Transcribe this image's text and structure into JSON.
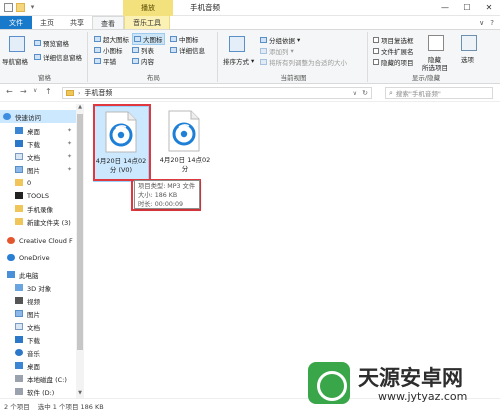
{
  "titlebar": {
    "context_tab": "播放",
    "window_title": "手机音频",
    "buttons": [
      "—",
      "☐",
      "✕"
    ]
  },
  "tabs": {
    "file": "文件",
    "home": "主页",
    "share": "共享",
    "view": "查看",
    "music_tools": "音乐工具",
    "right_icons": [
      "∨",
      "?"
    ]
  },
  "ribbon": {
    "panes": {
      "nav_pane": "导航窗格",
      "preview_pane": "预览窗格",
      "details_pane": "详细信息窗格",
      "title": "窗格"
    },
    "layout": {
      "xlarge": "超大图标",
      "large": "大图标",
      "medium": "中图标",
      "small": "小图标",
      "list": "列表",
      "details": "详细信息",
      "tiles": "平铺",
      "content": "内容",
      "title": "布局"
    },
    "current_view": {
      "sort_by": "排序方式",
      "group_by": "分组依据",
      "add_columns": "添加列",
      "size_all_columns": "将所有列调整为合适的大小",
      "title": "当前视图"
    },
    "show_hide": {
      "item_checkboxes": "项目复选框",
      "file_extensions": "文件扩展名",
      "hidden_items": "隐藏的项目",
      "hide_selected": "隐藏",
      "hide_selected_2": "所选项目",
      "options": "选项",
      "title": "显示/隐藏"
    }
  },
  "address": {
    "back": "←",
    "forward": "→",
    "recent": "∨",
    "up": "↑",
    "path": "手机音频",
    "search_placeholder": "搜索\"手机音频\""
  },
  "nav": {
    "items": [
      {
        "label": "快速访问",
        "selected": true
      },
      {
        "label": "桌面",
        "pinned": true
      },
      {
        "label": "下载",
        "pinned": true
      },
      {
        "label": "文档",
        "pinned": true
      },
      {
        "label": "图片",
        "pinned": true
      },
      {
        "label": "0"
      },
      {
        "label": "TOOLS"
      },
      {
        "label": "手机录像"
      },
      {
        "label": "新建文件夹 (3)"
      },
      {
        "label": "Creative Cloud F"
      },
      {
        "label": "OneDrive"
      },
      {
        "label": "此电脑"
      },
      {
        "label": "3D 对象"
      },
      {
        "label": "视频"
      },
      {
        "label": "图片"
      },
      {
        "label": "文档"
      },
      {
        "label": "下载"
      },
      {
        "label": "音乐"
      },
      {
        "label": "桌面"
      },
      {
        "label": "本地磁盘 (C:)"
      },
      {
        "label": "软件 (D:)"
      }
    ],
    "pin_glyph": "✦"
  },
  "files": [
    {
      "name": "4月20日 14点02分 (V0)",
      "line1": "4月20日 14点02",
      "line2": "分 (V0)",
      "selected": true
    },
    {
      "name": "4月20日 14点02分",
      "line1": "4月20日 14点02",
      "line2": "分",
      "selected": false
    }
  ],
  "tooltip": {
    "type": "项目类型: MP3 文件",
    "size": "大小: 186 KB",
    "duration": "时长: 00:00:09"
  },
  "status": {
    "count": "2 个项目",
    "selected": "选中 1 个项目  186 KB"
  },
  "watermark": {
    "title": "天源安卓网",
    "url": "www.jytyaz.com"
  },
  "colors": {
    "accent": "#1979ca",
    "selection": "#cce8ff",
    "highlight_box": "#e0383e",
    "music_tab": "#f3e17e"
  }
}
